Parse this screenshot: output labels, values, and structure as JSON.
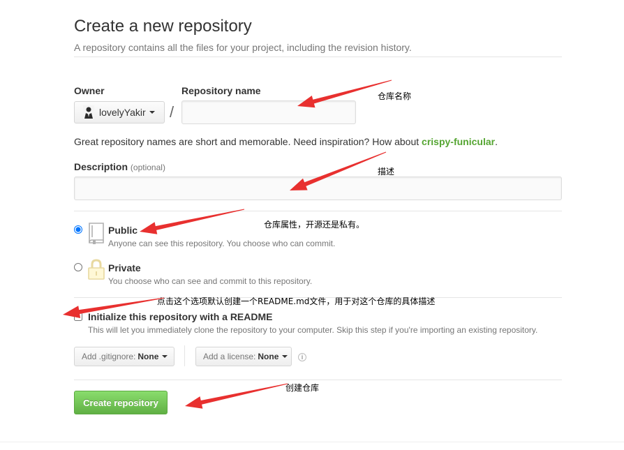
{
  "header": {
    "title": "Create a new repository",
    "subtitle": "A repository contains all the files for your project, including the revision history."
  },
  "owner": {
    "label": "Owner",
    "value": "lovelyYakir",
    "avatar_icon": "user-avatar-icon"
  },
  "repo_name": {
    "label": "Repository name",
    "separator": "/",
    "value": "",
    "placeholder": ""
  },
  "name_hint": {
    "prefix": "Great repository names are short and memorable. Need inspiration? How about ",
    "suggestion": "crispy-funicular",
    "suffix": "."
  },
  "description": {
    "label": "Description",
    "optional": "(optional)",
    "value": "",
    "placeholder": ""
  },
  "visibility": {
    "selected": "public",
    "public": {
      "title": "Public",
      "desc": "Anyone can see this repository. You choose who can commit.",
      "icon": "repo-book-icon"
    },
    "private": {
      "title": "Private",
      "desc": "You choose who can see and commit to this repository.",
      "icon": "lock-icon"
    }
  },
  "init_readme": {
    "checked": false,
    "title": "Initialize this repository with a README",
    "desc": "This will let you immediately clone the repository to your computer. Skip this step if you're importing an existing repository."
  },
  "gitignore": {
    "label": "Add .gitignore:",
    "value": "None"
  },
  "license": {
    "label": "Add a license:",
    "value": "None"
  },
  "info_icon": "i",
  "submit": {
    "label": "Create repository"
  },
  "annotations": {
    "repo_name": "仓库名称",
    "description": "描述",
    "visibility": "仓库属性，开源还是私有。",
    "readme": "点击这个选项默认创建一个README.md文件，用于对这个仓库的具体描述",
    "create": "创建仓库",
    "arrow_color": "#e8302f"
  },
  "colors": {
    "primary_button": "#6cc644",
    "suggestion_link": "#55a532",
    "muted_text": "#767676"
  }
}
